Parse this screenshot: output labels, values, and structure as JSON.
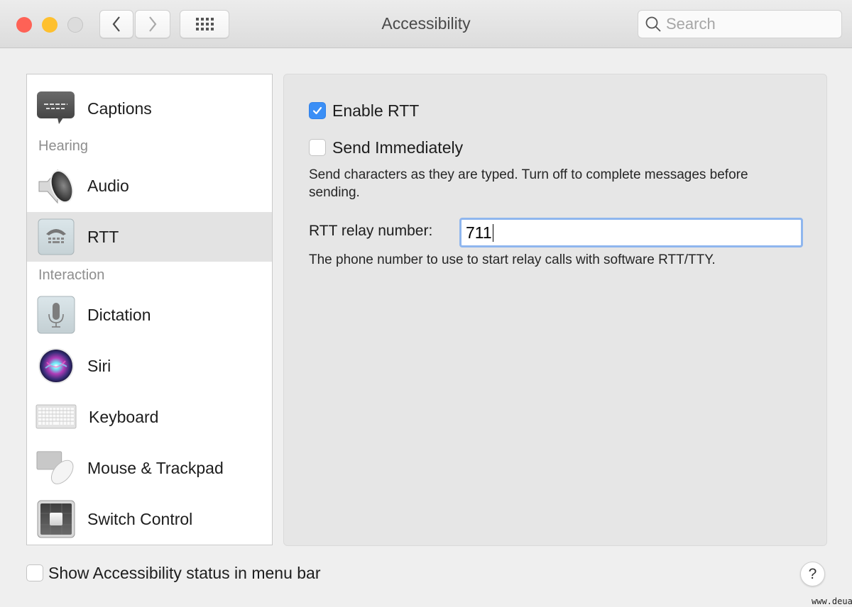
{
  "window": {
    "title": "Accessibility",
    "search_placeholder": "Search"
  },
  "sidebar": {
    "items": [
      {
        "label": "Captions",
        "icon": "captions-icon",
        "selected": false
      },
      {
        "label": "Audio",
        "icon": "speaker-icon",
        "selected": false
      },
      {
        "label": "RTT",
        "icon": "tty-phone-icon",
        "selected": true
      },
      {
        "label": "Dictation",
        "icon": "microphone-icon",
        "selected": false
      },
      {
        "label": "Siri",
        "icon": "siri-icon",
        "selected": false
      },
      {
        "label": "Keyboard",
        "icon": "keyboard-icon",
        "selected": false
      },
      {
        "label": "Mouse & Trackpad",
        "icon": "mouse-trackpad-icon",
        "selected": false
      },
      {
        "label": "Switch Control",
        "icon": "switch-control-icon",
        "selected": false
      }
    ],
    "sections": {
      "hearing": "Hearing",
      "interaction": "Interaction"
    }
  },
  "rtt": {
    "enable_label": "Enable RTT",
    "enable_checked": true,
    "send_immediately_label": "Send Immediately",
    "send_immediately_checked": false,
    "send_immediately_desc": "Send characters as they are typed. Turn off to complete messages before sending.",
    "relay_label": "RTT relay number:",
    "relay_value": "711",
    "relay_desc": "The phone number to use to start relay calls with software RTT/TTY."
  },
  "footer": {
    "status_label": "Show Accessibility status in menu bar",
    "status_checked": false,
    "help_label": "?"
  },
  "watermark": "www.deuaq.com",
  "colors": {
    "accent": "#3b8ff6",
    "focus_ring": "#8fb6ee",
    "close": "#fe6256",
    "minimize": "#fec02f"
  }
}
